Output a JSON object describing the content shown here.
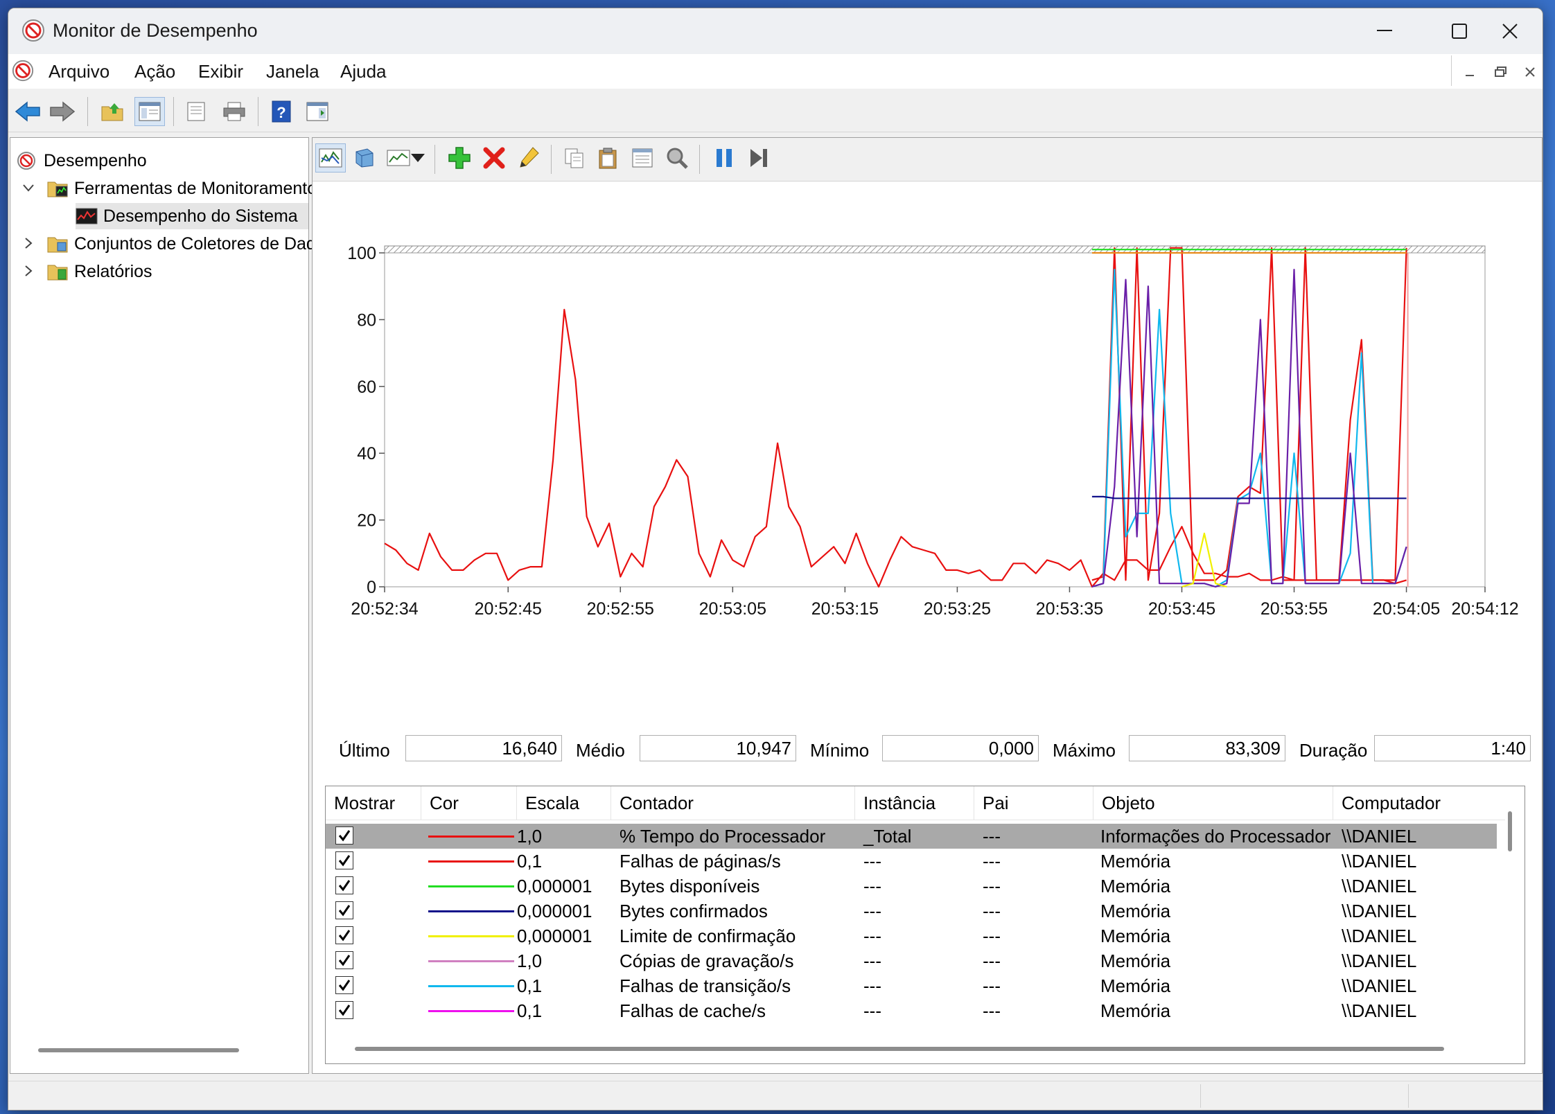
{
  "window": {
    "title": "Monitor de Desempenho"
  },
  "menu": [
    "Arquivo",
    "Ação",
    "Exibir",
    "Janela",
    "Ajuda"
  ],
  "tree": {
    "root": "Desempenho",
    "items": [
      {
        "label": "Ferramentas de Monitoramento",
        "expanded": true
      },
      {
        "label": "Desempenho do Sistema",
        "selected": true
      },
      {
        "label": "Conjuntos de Coletores de Dados",
        "expanded": false
      },
      {
        "label": "Relatórios",
        "expanded": false
      }
    ]
  },
  "stats": {
    "last_label": "Último",
    "last_value": "16,640",
    "avg_label": "Médio",
    "avg_value": "10,947",
    "min_label": "Mínimo",
    "min_value": "0,000",
    "max_label": "Máximo",
    "max_value": "83,309",
    "dur_label": "Duração",
    "dur_value": "1:40"
  },
  "legend": {
    "headers": [
      "Mostrar",
      "Cor",
      "Escala",
      "Contador",
      "Instância",
      "Pai",
      "Objeto",
      "Computador"
    ],
    "rows": [
      {
        "color": "#e81010",
        "scale": "1,0",
        "counter": "% Tempo do Processador",
        "instance": "_Total",
        "parent": "---",
        "object": "Informações do Processador",
        "computer": "\\\\DANIEL",
        "selected": true
      },
      {
        "color": "#e81010",
        "scale": "0,1",
        "counter": "Falhas de páginas/s",
        "instance": "---",
        "parent": "---",
        "object": "Memória",
        "computer": "\\\\DANIEL"
      },
      {
        "color": "#22dd22",
        "scale": "0,000001",
        "counter": "Bytes disponíveis",
        "instance": "---",
        "parent": "---",
        "object": "Memória",
        "computer": "\\\\DANIEL"
      },
      {
        "color": "#10108a",
        "scale": "0,000001",
        "counter": "Bytes confirmados",
        "instance": "---",
        "parent": "---",
        "object": "Memória",
        "computer": "\\\\DANIEL"
      },
      {
        "color": "#f0f000",
        "scale": "0,000001",
        "counter": "Limite de confirmação",
        "instance": "---",
        "parent": "---",
        "object": "Memória",
        "computer": "\\\\DANIEL"
      },
      {
        "color": "#d080c0",
        "scale": "1,0",
        "counter": "Cópias de gravação/s",
        "instance": "---",
        "parent": "---",
        "object": "Memória",
        "computer": "\\\\DANIEL"
      },
      {
        "color": "#10b8ee",
        "scale": "0,1",
        "counter": "Falhas de transição/s",
        "instance": "---",
        "parent": "---",
        "object": "Memória",
        "computer": "\\\\DANIEL"
      },
      {
        "color": "#ee10ee",
        "scale": "0,1",
        "counter": "Falhas de cache/s",
        "instance": "---",
        "parent": "---",
        "object": "Memória",
        "computer": "\\\\DANIEL"
      }
    ]
  },
  "chart_data": {
    "type": "line",
    "ylim": [
      0,
      100
    ],
    "yticks": [
      0,
      20,
      40,
      60,
      80,
      100
    ],
    "xlim": [
      0,
      98
    ],
    "xticks": [
      {
        "t": 0,
        "label": "20:52:34"
      },
      {
        "t": 11,
        "label": "20:52:45"
      },
      {
        "t": 21,
        "label": "20:52:55"
      },
      {
        "t": 31,
        "label": "20:53:05"
      },
      {
        "t": 41,
        "label": "20:53:15"
      },
      {
        "t": 51,
        "label": "20:53:25"
      },
      {
        "t": 61,
        "label": "20:53:35"
      },
      {
        "t": 71,
        "label": "20:53:45"
      },
      {
        "t": 81,
        "label": "20:53:55"
      },
      {
        "t": 91,
        "label": "20:54:05"
      },
      {
        "t": 98,
        "label": "20:54:12"
      }
    ],
    "series": [
      {
        "color": "#e81010",
        "x": [
          0,
          1,
          2,
          3,
          4,
          5,
          6,
          7,
          8,
          9,
          10,
          11,
          12,
          13,
          14,
          15,
          16,
          17,
          18,
          19,
          20,
          21,
          22,
          23,
          24,
          25,
          26,
          27,
          28,
          29,
          30,
          31,
          32,
          33,
          34,
          35,
          36,
          37,
          38,
          39,
          40,
          41,
          42,
          43,
          44,
          45,
          46,
          47,
          48,
          49,
          50,
          51,
          52,
          53,
          54,
          55,
          56,
          57,
          58,
          59,
          60,
          61,
          62,
          63,
          64,
          65,
          66,
          67,
          68,
          69,
          70,
          71,
          72,
          73,
          74,
          75,
          76,
          77,
          78,
          79,
          80,
          81,
          82,
          83,
          84,
          85,
          86,
          87,
          88,
          89,
          90,
          91
        ],
        "y": [
          13,
          11,
          7,
          5,
          16,
          9,
          5,
          5,
          8,
          10,
          10,
          2,
          5,
          6,
          6,
          38,
          83,
          62,
          21,
          12,
          19,
          3,
          10,
          6,
          24,
          30,
          38,
          33,
          10,
          3,
          14,
          8,
          6,
          15,
          18,
          43,
          24,
          18,
          6,
          9,
          12,
          7,
          16,
          7,
          0,
          8,
          15,
          12,
          11,
          10,
          5,
          5,
          4,
          5,
          2,
          2,
          7,
          7,
          4,
          8,
          7,
          5,
          8,
          0,
          4,
          2,
          8,
          8,
          5,
          5,
          12,
          18,
          10,
          4,
          4,
          3,
          3,
          4,
          2,
          2,
          3,
          2,
          2,
          2,
          2,
          2,
          2,
          2,
          2,
          2,
          1,
          2
        ]
      },
      {
        "color": "#e81010",
        "x": [
          63,
          64,
          65,
          66,
          67,
          68,
          69,
          70,
          71,
          72,
          73,
          74,
          75,
          76,
          77,
          78,
          79,
          80,
          81,
          82,
          83,
          84,
          85,
          86,
          87,
          88,
          89,
          90,
          91
        ],
        "y": [
          2,
          3,
          102,
          2,
          102,
          2,
          22,
          102,
          102,
          2,
          2,
          2,
          5,
          27,
          30,
          28,
          102,
          2,
          2,
          102,
          2,
          2,
          2,
          50,
          74,
          2,
          2,
          2,
          102
        ]
      },
      {
        "color": "#10b8ee",
        "x": [
          63,
          64,
          65,
          66,
          67,
          68,
          69,
          70,
          71,
          72,
          73,
          74,
          75,
          76,
          77,
          78,
          79,
          80,
          81,
          82,
          83,
          84,
          85,
          86,
          87,
          88,
          89,
          90,
          91
        ],
        "y": [
          0,
          1,
          95,
          15,
          22,
          22,
          83,
          22,
          1,
          1,
          1,
          0,
          2,
          26,
          28,
          40,
          1,
          1,
          40,
          1,
          1,
          1,
          1,
          10,
          70,
          1,
          1,
          1,
          12
        ]
      },
      {
        "color": "#6a1fa8",
        "x": [
          63,
          64,
          65,
          66,
          67,
          68,
          69,
          70,
          71,
          72,
          73,
          74,
          75,
          76,
          77,
          78,
          79,
          80,
          81,
          82,
          83,
          84,
          85,
          86,
          87,
          88,
          89,
          90,
          91
        ],
        "y": [
          0,
          1,
          30,
          92,
          15,
          90,
          1,
          1,
          1,
          1,
          1,
          0,
          1,
          25,
          25,
          80,
          1,
          1,
          95,
          1,
          1,
          1,
          1,
          40,
          1,
          1,
          1,
          1,
          12
        ]
      },
      {
        "color": "#10108a",
        "x": [
          63,
          64,
          65,
          66,
          91
        ],
        "y": [
          27,
          27,
          26.5,
          26.5,
          26.5
        ]
      },
      {
        "color": "#f0f000",
        "x": [
          71,
          72,
          73,
          74,
          75
        ],
        "y": [
          0,
          1,
          16,
          1,
          0
        ]
      },
      {
        "color": "#22dd22",
        "x": [
          63,
          91
        ],
        "y": [
          101,
          101
        ]
      },
      {
        "color": "#e88a1a",
        "x": [
          63,
          91
        ],
        "y": [
          100,
          100
        ]
      }
    ]
  }
}
